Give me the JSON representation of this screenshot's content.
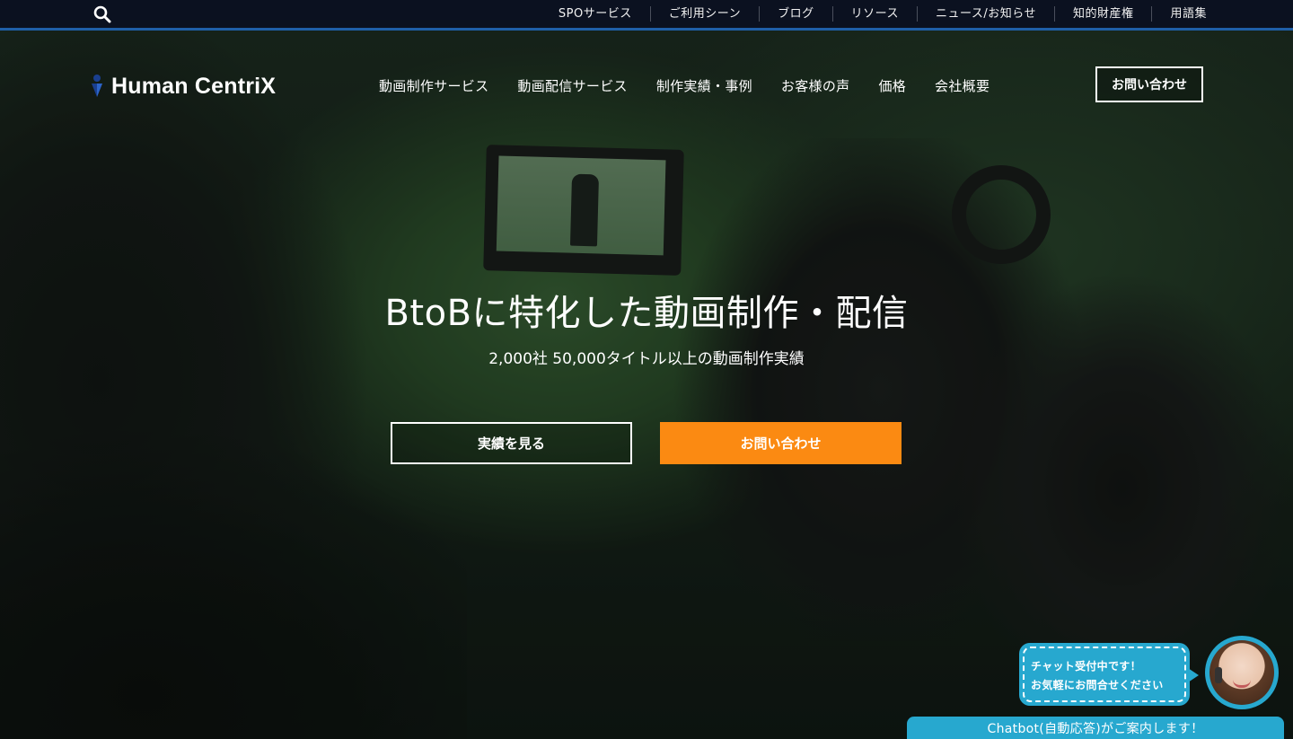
{
  "topbar": {
    "search_icon": "search-icon",
    "links": [
      "SPOサービス",
      "ご利用シーン",
      "ブログ",
      "リソース",
      "ニュース/お知らせ",
      "知的財産権",
      "用語集"
    ]
  },
  "header": {
    "logo_text": "Human CentriX",
    "nav": [
      "動画制作サービス",
      "動画配信サービス",
      "制作実績・事例",
      "お客様の声",
      "価格",
      "会社概要"
    ],
    "contact_label": "お問い合わせ"
  },
  "hero": {
    "title": "BtoBに特化した動画制作・配信",
    "subtitle": "2,000社 50,000タイトル以上の動画制作実績",
    "btn_works": "実績を見る",
    "btn_contact": "お問い合わせ"
  },
  "chat": {
    "bubble_line1": "チャット受付中です！",
    "bubble_line2": "お気軽にお問合せください",
    "bar_label": "Chatbot(自動応答)がご案内します！"
  },
  "colors": {
    "topbar_bg": "#0b1120",
    "topbar_accent": "#1f5fa8",
    "cta_orange": "#fb8a12",
    "chat_blue": "#27a8cf"
  }
}
